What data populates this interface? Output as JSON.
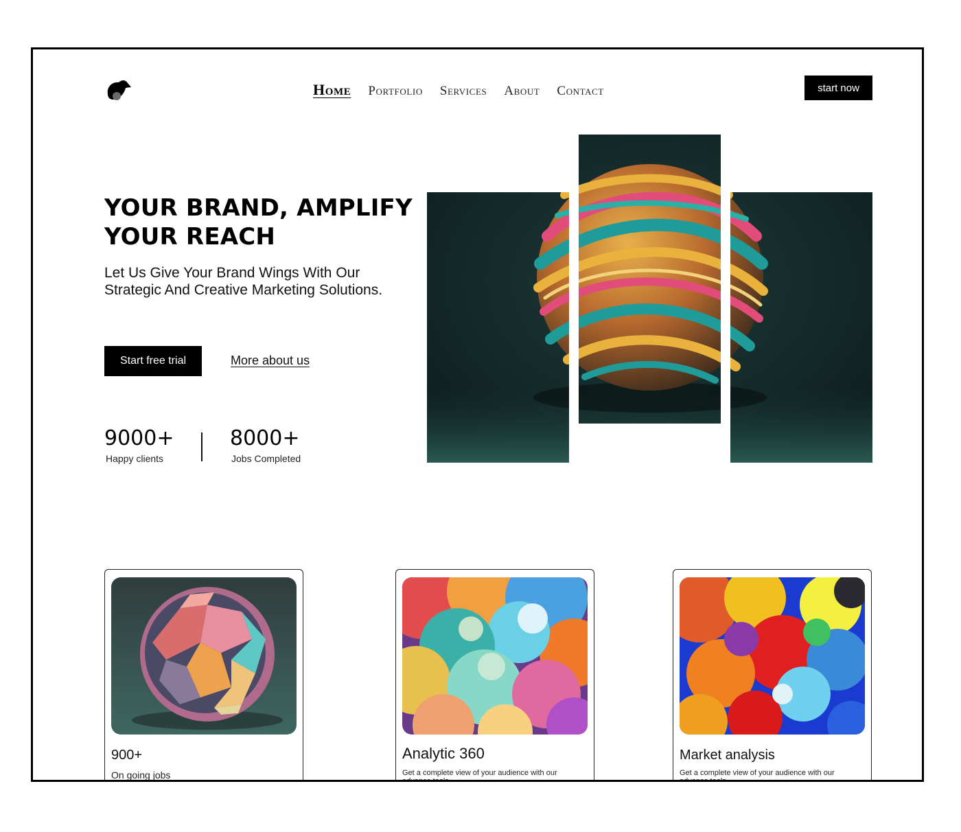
{
  "nav": {
    "items": [
      {
        "label": "Home",
        "active": true
      },
      {
        "label": "Portfolio",
        "active": false
      },
      {
        "label": "Services",
        "active": false
      },
      {
        "label": "About",
        "active": false
      },
      {
        "label": "Contact",
        "active": false
      }
    ],
    "cta_label": "start now"
  },
  "logo": {
    "icon": "bird-logo-icon"
  },
  "hero": {
    "title": "YOUR BRAND, AMPLIFY YOUR REACH",
    "subtitle": "Let Us Give Your Brand Wings With Our Strategic And Creative Marketing Solutions.",
    "primary_button": "Start free trial",
    "secondary_link": "More about us"
  },
  "stats": [
    {
      "value": "9000+",
      "label": "Happy clients"
    },
    {
      "value": "8000+",
      "label": "Jobs Completed"
    }
  ],
  "cards": [
    {
      "title": "900+",
      "description": "On going jobs"
    },
    {
      "title": "Analytic 360",
      "description": "Get a complete view of your audience with our advance tools"
    },
    {
      "title": "Market analysis",
      "description": "Get a complete view of your audience with our advance tools"
    }
  ],
  "colors": {
    "primary": "#000000",
    "background": "#ffffff",
    "hero_panel_bg": "#152a2b"
  }
}
